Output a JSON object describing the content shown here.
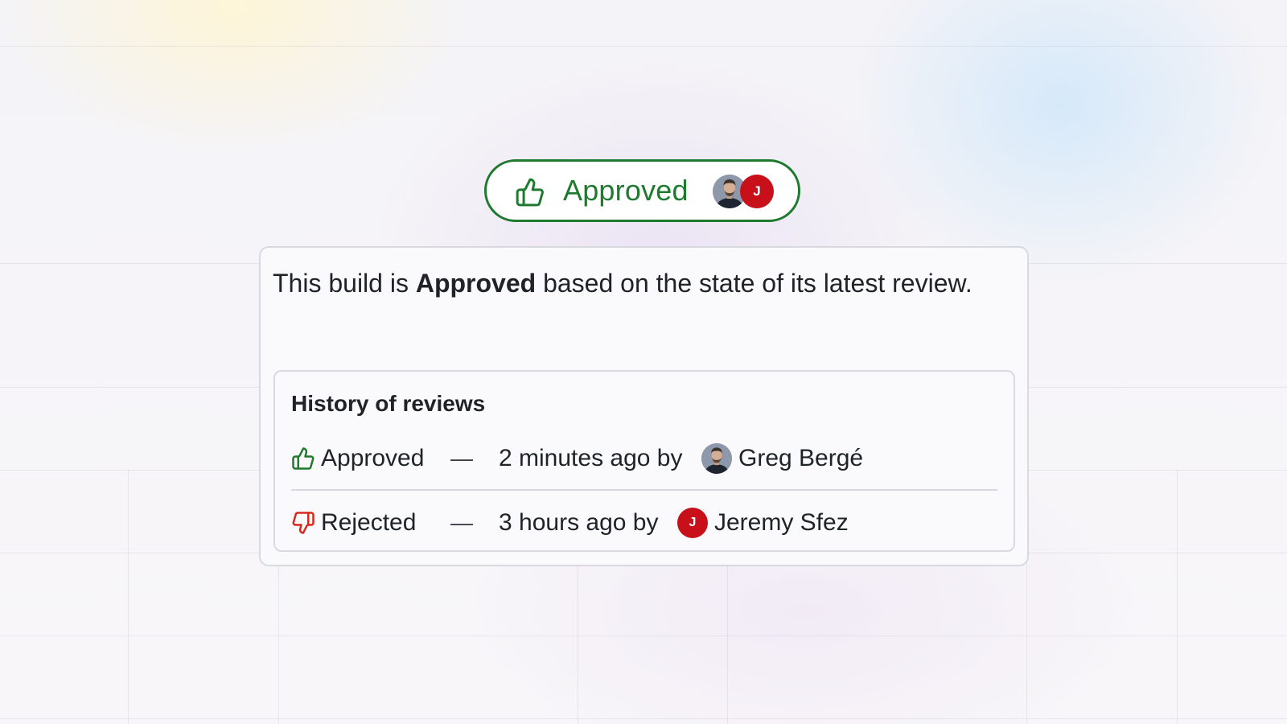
{
  "badge": {
    "label": "Approved",
    "icon": "thumbs-up-icon",
    "color": "#1f7a2f",
    "avatars": [
      {
        "name": "Greg Bergé",
        "type": "photo"
      },
      {
        "name": "Jeremy Sfez",
        "initial": "J",
        "color": "#c8101b"
      }
    ]
  },
  "card": {
    "description_prefix": "This build is ",
    "description_status": "Approved",
    "description_suffix": " based on the state of its latest review.",
    "history": {
      "title": "History of reviews",
      "reviews": [
        {
          "status": "Approved",
          "icon": "thumbs-up-icon",
          "icon_color": "#1f7a2f",
          "separator": "—",
          "time": "2 minutes ago by",
          "reviewer": "Greg Bergé",
          "avatar_type": "photo"
        },
        {
          "status": "Rejected",
          "icon": "thumbs-down-icon",
          "icon_color": "#d42a1e",
          "separator": "—",
          "time": "3 hours ago by",
          "reviewer": "Jeremy Sfez",
          "avatar_type": "initial",
          "avatar_initial": "J",
          "avatar_color": "#c8101b"
        }
      ]
    }
  }
}
